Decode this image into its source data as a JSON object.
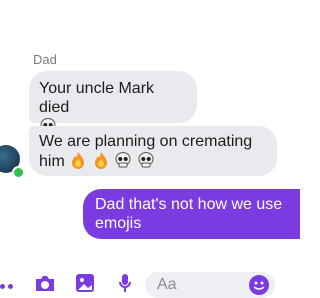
{
  "thread": {
    "sender_name": "Dad",
    "messages": [
      {
        "from": "Dad",
        "text": "Your uncle Mark died",
        "emojis": [
          "skull"
        ]
      },
      {
        "from": "Dad",
        "text": "We are planning on cremating",
        "text2": "him",
        "emojis": [
          "fire",
          "fire",
          "skull",
          "skull"
        ]
      },
      {
        "from": "me",
        "text": "Dad that's not how we use emojis"
      }
    ]
  },
  "composer": {
    "placeholder": "Aa",
    "icons": [
      "more-icon",
      "camera-icon",
      "photo-icon",
      "mic-icon",
      "smile-icon"
    ]
  },
  "colors": {
    "accent": "#7a3be0",
    "incoming_bubble": "#e9eaee",
    "online": "#31c24d"
  }
}
